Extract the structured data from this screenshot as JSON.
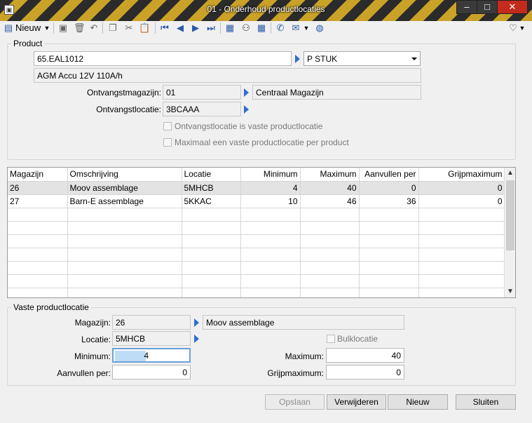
{
  "window": {
    "title": "01 - Onderhoud productlocaties"
  },
  "toolbar": {
    "new_label": "Nieuw"
  },
  "product": {
    "group_label": "Product",
    "code": "65.EAL1012",
    "unit": "P STUK",
    "description": "AGM Accu 12V 110A/h",
    "warehouse_label": "Ontvangstmagazijn:",
    "warehouse_code": "01",
    "warehouse_name": "Centraal Magazijn",
    "location_label": "Ontvangstlocatie:",
    "location_code": "3BCAAA",
    "chk1_label": "Ontvangstlocatie is vaste productlocatie",
    "chk2_label": "Maximaal een vaste productlocatie per product"
  },
  "table": {
    "columns": [
      "Magazijn",
      "Omschrijving",
      "Locatie",
      "Minimum",
      "Maximum",
      "Aanvullen per",
      "Grijpmaximum"
    ],
    "rows": [
      [
        "26",
        "Moov assemblage",
        "5MHCB",
        "4",
        "40",
        "0",
        "0"
      ],
      [
        "27",
        "Barn-E assemblage",
        "5KKAC",
        "10",
        "46",
        "36",
        "0"
      ]
    ]
  },
  "fixed": {
    "group_label": "Vaste productlocatie",
    "warehouse_label": "Magazijn:",
    "warehouse_code": "26",
    "warehouse_name": "Moov assemblage",
    "location_label": "Locatie:",
    "location_code": "5MHCB",
    "bulk_label": "Bulklocatie",
    "minimum_label": "Minimum:",
    "minimum_value": "4",
    "maximum_label": "Maximum:",
    "maximum_value": "40",
    "refill_label": "Aanvullen per:",
    "refill_value": "0",
    "grab_label": "Grijpmaximum:",
    "grab_value": "0"
  },
  "buttons": {
    "save": "Opslaan",
    "delete": "Verwijderen",
    "new": "Nieuw",
    "close": "Sluiten"
  }
}
